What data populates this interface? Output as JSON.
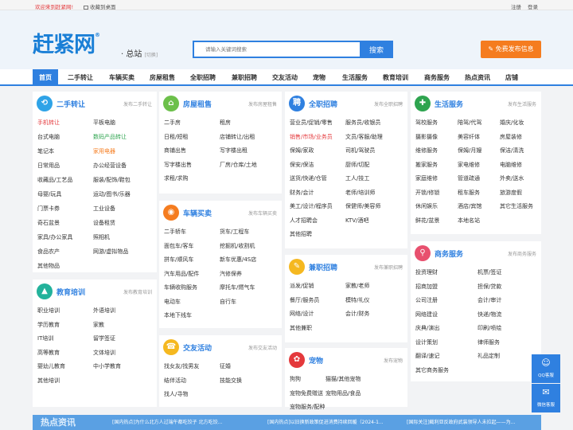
{
  "topbar": {
    "welcome": "欢迎来到赶紧网!",
    "favorite": "收藏到桌面",
    "register": "注册",
    "login": "登录"
  },
  "header": {
    "logo": "赶紧网",
    "city": "总站",
    "city_switch": "[切换]",
    "search_placeholder": "请输入关键词搜索",
    "search_button": "搜索",
    "post_button": "免费发布信息"
  },
  "nav": [
    "首页",
    "二手转让",
    "车辆买卖",
    "房屋租售",
    "全职招聘",
    "兼职招聘",
    "交友活动",
    "宠物",
    "生活服务",
    "教育培训",
    "商务服务",
    "热点资讯",
    "店铺"
  ],
  "cards": {
    "secondhand": {
      "title": "二手转让",
      "post": "发布二手转让",
      "icon": "⟲",
      "color": "#2fa3e7",
      "items": [
        "手机转让",
        "平板电脑",
        "台式电脑",
        "数码产品转让",
        "笔记本",
        "家用电器",
        "日常用品",
        "办公经营设备",
        "收藏品/工艺品",
        "服装/配饰/鞋包",
        "母婴/玩具",
        "运动/图书/乐器",
        "门票卡券",
        "工业设备",
        "奇石盆景",
        "设备租赁",
        "家具/办公家具",
        "照相机",
        "食品农产",
        "网游/虚拟物品",
        "其他物品"
      ]
    },
    "education": {
      "title": "教育培训",
      "post": "发布教育培训",
      "icon": "▲",
      "color": "#23b29b",
      "items": [
        "职业培训",
        "外语培训",
        "学历教育",
        "家教",
        "IT培训",
        "留学签证",
        "高等教育",
        "文体培训",
        "婴幼儿教育",
        "中小学教育",
        "其他培训"
      ]
    },
    "house": {
      "title": "房屋租售",
      "post": "发布房屋租售",
      "icon": "⌂",
      "color": "#6cc04a",
      "items": [
        "二手房",
        "租房",
        "日租/短租",
        "店铺转让/出租",
        "商铺出售",
        "写字楼出租",
        "写字楼出售",
        "厂房/仓库/土地",
        "求租/求购"
      ]
    },
    "car": {
      "title": "车辆买卖",
      "post": "发布车辆买卖",
      "icon": "◉",
      "color": "#f57c1f",
      "items": [
        "二手轿车",
        "货车/工程车",
        "面包车/客车",
        "挖掘机/收割机",
        "拼车/顺风车",
        "新车优惠/4S店",
        "汽车用品/配件",
        "汽修保养",
        "车辆收购服务",
        "摩托车/燃气车",
        "电动车",
        "自行车",
        "本地下线车"
      ]
    },
    "social": {
      "title": "交友活动",
      "post": "发布交友活动",
      "icon": "☎",
      "color": "#f5b820",
      "items": [
        "找女友/找男友",
        "征婚",
        "结伴活动",
        "技能交换",
        "找人/寻物"
      ]
    },
    "fulltime": {
      "title": "全职招聘",
      "post": "发布全职招聘",
      "icon": "聘",
      "color": "#2f80e0",
      "items": [
        "营业员/促销/零售",
        "服务员/收银员",
        "销售/市场/业务员",
        "文员/客服/助理",
        "保姆/家政",
        "司机/驾驶员",
        "保安/保洁",
        "厨师/切配",
        "送货/快递/仓管",
        "工人/技工",
        "财务/会计",
        "老师/培训师",
        "美工/设计/程序员",
        "保健师/美容师",
        "人才招聘会",
        "KTV/酒吧",
        "其他招聘"
      ]
    },
    "parttime": {
      "title": "兼职招聘",
      "post": "发布兼职招聘",
      "icon": "✎",
      "color": "#f5b820",
      "items": [
        "派发/促销",
        "家教/老师",
        "餐厅/服务员",
        "模特/礼仪",
        "网络/设计",
        "会计/财务",
        "其他兼职"
      ]
    },
    "pet": {
      "title": "宠物",
      "post": "发布宠物",
      "icon": "✿",
      "color": "#e4393c",
      "items": [
        "狗狗",
        "猫猫/其他宠物",
        "宠物免费赠送",
        "宠物用品/食品",
        "宠物服务/配种"
      ]
    },
    "life": {
      "title": "生活服务",
      "post": "发布生活服务",
      "icon": "✚",
      "color": "#2ea44f",
      "items": [
        "驾校服务",
        "陪驾/代驾",
        "婚庆/化妆",
        "摄影摄像",
        "美容纤体",
        "房屋装修",
        "维修服务",
        "保姆/月嫂",
        "保洁/清洗",
        "搬家服务",
        "家电维修",
        "电脑维修",
        "家庭维修",
        "管道疏通",
        "外卖/送水",
        "开锁/修锁",
        "租车服务",
        "旅游度假",
        "休闲娱乐",
        "酒店/宾馆",
        "其它生活服务",
        "鲜花/盆景",
        "本地名站"
      ]
    },
    "business": {
      "title": "商务服务",
      "post": "发布商务服务",
      "icon": "⚲",
      "color": "#e8506e",
      "items": [
        "投资理财",
        "机票/签证",
        "招商加盟",
        "担保/贷款",
        "公司注册",
        "会计/审计",
        "网络建设",
        "快递/物流",
        "庆典/演出",
        "印刷/喷绘",
        "设计策划",
        "律师服务",
        "翻译/速记",
        "礼品定制",
        "其它商务服务"
      ]
    }
  },
  "floats": [
    {
      "label": "QQ客服",
      "icon": "☺"
    },
    {
      "label": "微信客服",
      "icon": "✉"
    }
  ],
  "bottom": {
    "label": "热点资讯",
    "news": [
      "[国内热点]为什么北方人过端午都吃饺子 北方吃饺...",
      "[国内热点]以旧换新政策促进消费持续回暖（2024-1...",
      "[国际关注]截利亚反政府武装领导人未拉起——为..."
    ]
  }
}
